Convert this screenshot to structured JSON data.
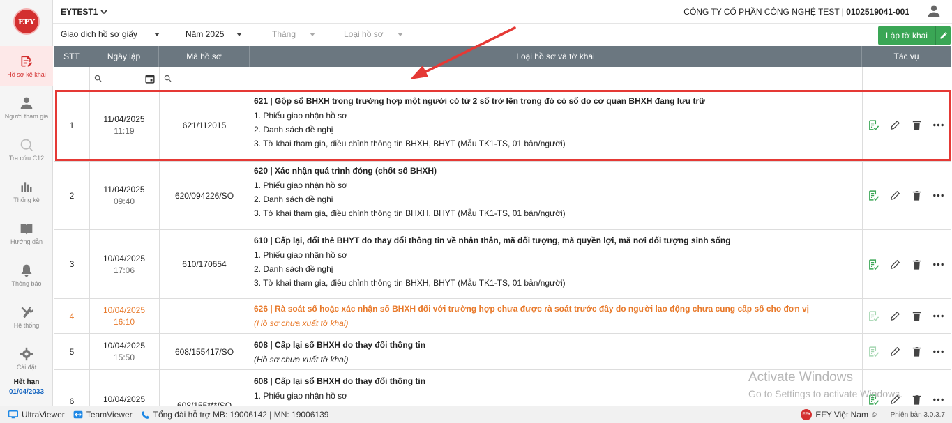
{
  "sidebar": {
    "logo": "EFY",
    "items": [
      {
        "label": "Hồ sơ kê khai"
      },
      {
        "label": "Người tham gia"
      },
      {
        "label": "Tra cứu C12"
      },
      {
        "label": "Thống kê"
      },
      {
        "label": "Hướng dẫn"
      },
      {
        "label": "Thông báo"
      },
      {
        "label": "Hệ thống"
      },
      {
        "label": "Cài đặt"
      }
    ],
    "expire_label": "Hết hạn",
    "expire_date": "01/04/2033"
  },
  "header": {
    "tenant": "EYTEST1",
    "company": "CÔNG TY CỔ PHẦN CÔNG NGHỆ TEST",
    "tax_code": "0102519041-001"
  },
  "filters": {
    "type": "Giao dịch hồ sơ giấy",
    "year": "Năm 2025",
    "month": "Tháng",
    "record_type": "Loại hồ sơ",
    "create_button": "Lập tờ khai"
  },
  "table": {
    "headers": [
      "STT",
      "Ngày lập",
      "Mã hồ sơ",
      "Loại hồ sơ và tờ khai",
      "Tác vụ"
    ],
    "rows": [
      {
        "stt": "1",
        "date": "11/04/2025",
        "time": "11:19",
        "code": "621/112015",
        "title": "621 | Gộp sổ BHXH trong trường hợp một người có từ 2 số trở lên trong đó có sổ do cơ quan BHXH đang lưu trữ",
        "items": [
          "1. Phiếu giao nhận hồ sơ",
          "2. Danh sách đề nghị",
          "3. Tờ khai tham gia, điều chỉnh thông tin BHXH, BHYT (Mẫu TK1-TS, 01 bản/người)"
        ]
      },
      {
        "stt": "2",
        "date": "11/04/2025",
        "time": "09:40",
        "code": "620/094226/SO",
        "title": "620 | Xác nhận quá trình đóng (chốt sổ BHXH)",
        "items": [
          "1. Phiếu giao nhận hồ sơ",
          "2. Danh sách đề nghị",
          "3. Tờ khai tham gia, điều chỉnh thông tin BHXH, BHYT (Mẫu TK1-TS, 01 bản/người)"
        ]
      },
      {
        "stt": "3",
        "date": "10/04/2025",
        "time": "17:06",
        "code": "610/170654",
        "title": "610 | Cấp lại, đổi thẻ BHYT do thay đổi thông tin về nhân thân, mã đối tượng, mã quyền lợi, mã nơi đối tượng sinh sống",
        "items": [
          "1. Phiếu giao nhận hồ sơ",
          "2. Danh sách đề nghị",
          "3. Tờ khai tham gia, điều chỉnh thông tin BHXH, BHYT (Mẫu TK1-TS, 01 bản/người)"
        ]
      },
      {
        "stt": "4",
        "date": "10/04/2025",
        "time": "16:10",
        "code": "",
        "title": "626 | Rà soát sổ hoặc xác nhận sổ BHXH đối với trường hợp chưa được rà soát trước đây do người lao động chưa cung cấp sổ cho đơn vị",
        "note": "(Hồ sơ chưa xuất tờ khai)"
      },
      {
        "stt": "5",
        "date": "10/04/2025",
        "time": "15:50",
        "code": "608/155417/SO",
        "title": "608 | Cấp lại sổ BHXH do thay đổi thông tin",
        "note": "(Hồ sơ chưa xuất tờ khai)"
      },
      {
        "stt": "6",
        "date": "10/04/2025",
        "time": "",
        "code": "608/155***/SO",
        "title": "608 | Cấp lại sổ BHXH do thay đổi thông tin",
        "items": [
          "1. Phiếu giao nhận hồ sơ"
        ]
      }
    ]
  },
  "bottom": {
    "ultraviewer": "UltraViewer",
    "teamviewer": "TeamViewer",
    "support": "Tổng đài hỗ trợ MB: 19006142 | MN: 19006139",
    "brand": "EFY Việt Nam",
    "version": "Phiên bản 3.0.3.7"
  },
  "watermark": {
    "line1": "Activate Windows",
    "line2": "Go to Settings to activate Windows."
  },
  "colors": {
    "accent": "#d32f2f",
    "header": "#6b7780",
    "create": "#3aa655",
    "warn": "#e8792a"
  }
}
